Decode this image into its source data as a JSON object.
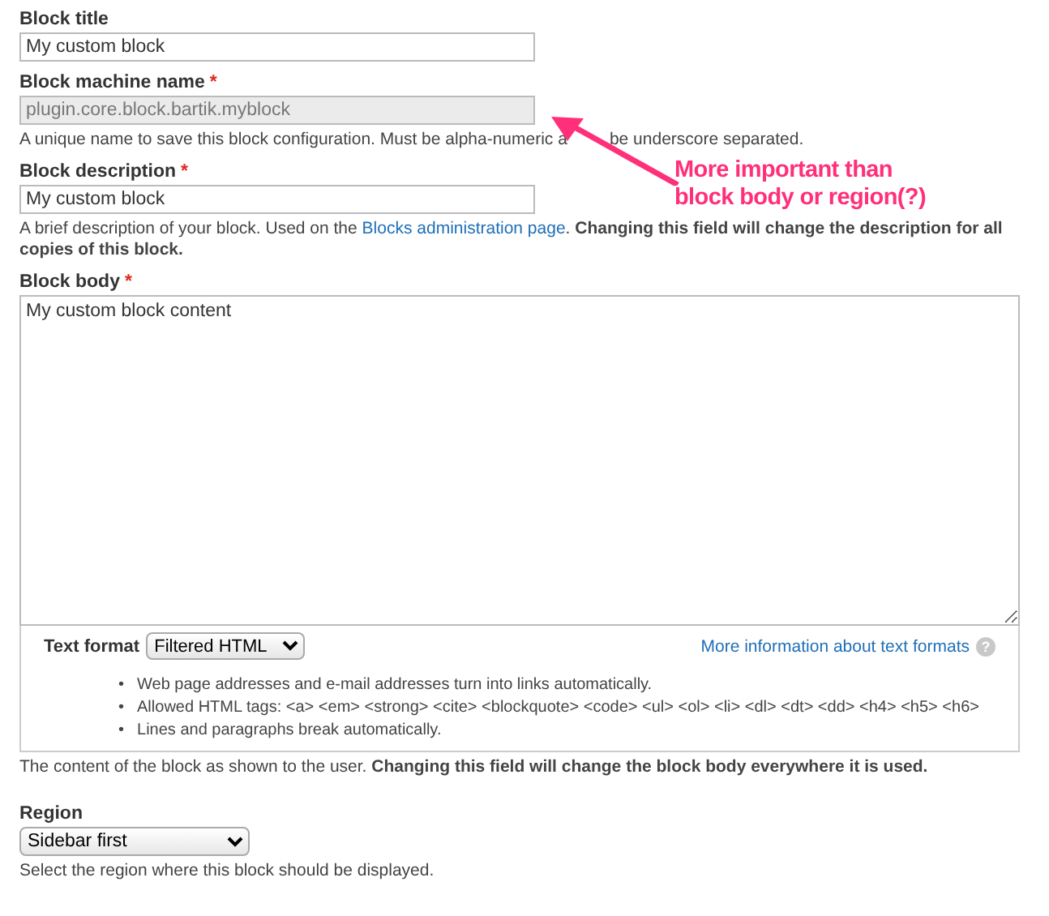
{
  "fields": [
    {
      "kind": "input",
      "label": "Block title",
      "disabled": false,
      "value": "My custom block"
    },
    {
      "kind": "input",
      "label": "Block machine name",
      "required_mark": "*",
      "disabled": true,
      "value": "plugin.core.block.bartik.myblock",
      "description": [
        {
          "kind": "text",
          "text": "A unique name to save this block configuration. Must be alpha-numeric a"
        },
        {
          "kind": "gap"
        },
        {
          "kind": "text",
          "text": "be underscore separated."
        }
      ]
    },
    {
      "kind": "input",
      "label": "Block description",
      "required_mark": "*",
      "disabled": false,
      "value": "My custom block",
      "description": [
        {
          "kind": "text",
          "text": "A brief description of your block. Used on the "
        },
        {
          "kind": "link",
          "text": "Blocks administration page"
        },
        {
          "kind": "text",
          "text": ". "
        },
        {
          "kind": "bold",
          "text": "Changing this field will change the description for all copies of this block."
        }
      ]
    },
    {
      "kind": "textarea",
      "label": "Block body",
      "required_mark": "*",
      "value": "My custom block content",
      "format": {
        "label": "Text format",
        "selected": "Filtered HTML",
        "help_link": "More information about text formats",
        "help_icon": "?",
        "tips": [
          {
            "marker": "•",
            "text": "Web page addresses and e-mail addresses turn into links automatically."
          },
          {
            "marker": "•",
            "text": "Allowed HTML tags: <a> <em> <strong> <cite> <blockquote> <code> <ul> <ol> <li> <dl> <dt> <dd> <h4> <h5> <h6>"
          },
          {
            "marker": "•",
            "text": "Lines and paragraphs break automatically."
          }
        ]
      },
      "description": [
        {
          "kind": "text",
          "text": "The content of the block as shown to the user. "
        },
        {
          "kind": "bold",
          "text": "Changing this field will change the block body everywhere it is used."
        }
      ]
    },
    {
      "kind": "select",
      "label": "Region",
      "value": "Sidebar first",
      "description": [
        {
          "kind": "text",
          "text": "Select the region where this block should be displayed."
        }
      ]
    }
  ],
  "annotation": {
    "lines": [
      "More important than",
      "block body or region(?)"
    ]
  }
}
